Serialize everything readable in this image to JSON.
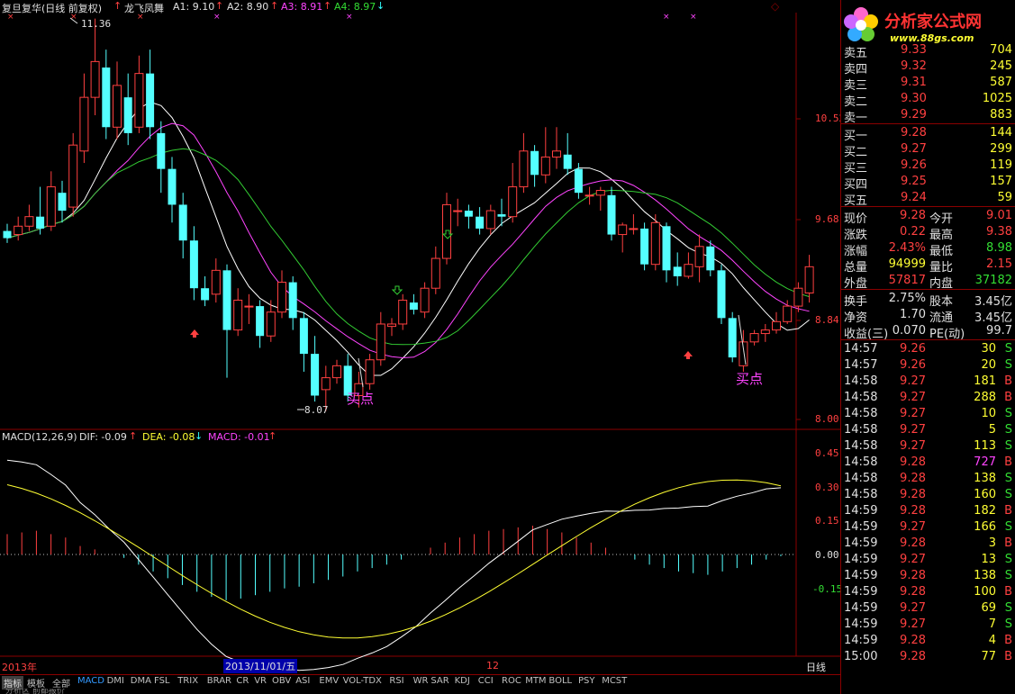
{
  "header": {
    "stock_name": "复旦复华(日线 前复权)",
    "diamond_icon": "◇",
    "indicator_name": "龙飞凤舞",
    "a1_label": "A1: 9.10",
    "a2_label": "A2: 8.90",
    "a3_label": "A3: 8.91",
    "a4_label": "A4: 8.97"
  },
  "main_chart": {
    "price_axis": [
      "10.52",
      "9.68",
      "8.84",
      "8.00"
    ],
    "high_annotation": "11.36",
    "low_annotation": "8.07",
    "buy_label_1": "买点",
    "buy_label_2": "买点",
    "ma_colors": {
      "white": "#ffffff",
      "magenta": "#ff44ff",
      "green": "#33cc33"
    },
    "up_color": "#ff4040",
    "down_color": "#54ffff"
  },
  "macd": {
    "header_name": "MACD(12,26,9)",
    "dif_label": "DIF: -0.09",
    "dea_label": "DEA: -0.08",
    "macd_label": "MACD: -0.01",
    "axis": [
      "0.45",
      "0.30",
      "0.15",
      "0.00",
      "-0.15"
    ]
  },
  "x_axis": {
    "year_label": "2013年",
    "date_label": "2013/11/01/五",
    "month_label": "12",
    "period_label": "日线"
  },
  "tabs": [
    "指标",
    "模板",
    "全部",
    "MACD",
    "DMI",
    "DMA",
    "FSL",
    "TRIX",
    "BRAR",
    "CR",
    "VR",
    "OBV",
    "ASI",
    "EMV",
    "VOL-TDX",
    "RSI",
    "WR",
    "SAR",
    "KDJ",
    "CCI",
    "ROC",
    "MTM",
    "BOLL",
    "PSY",
    "MCST"
  ],
  "bottom_text": "分析区 前都报价",
  "logo": {
    "title": "分析家公式网",
    "url": "www.88gs.com"
  },
  "order_book": {
    "sell": [
      {
        "label": "卖五",
        "price": "9.33",
        "volume": "704"
      },
      {
        "label": "卖四",
        "price": "9.32",
        "volume": "245"
      },
      {
        "label": "卖三",
        "price": "9.31",
        "volume": "587"
      },
      {
        "label": "卖二",
        "price": "9.30",
        "volume": "1025"
      },
      {
        "label": "卖一",
        "price": "9.29",
        "volume": "883"
      }
    ],
    "buy": [
      {
        "label": "买一",
        "price": "9.28",
        "volume": "144"
      },
      {
        "label": "买二",
        "price": "9.27",
        "volume": "299"
      },
      {
        "label": "买三",
        "price": "9.26",
        "volume": "119"
      },
      {
        "label": "买四",
        "price": "9.25",
        "volume": "157"
      },
      {
        "label": "买五",
        "price": "9.24",
        "volume": "59"
      }
    ]
  },
  "quote": [
    {
      "l1": "现价",
      "v1": "9.28",
      "l2": "今开",
      "v2": "9.01"
    },
    {
      "l1": "涨跌",
      "v1": "0.22",
      "l2": "最高",
      "v2": "9.38"
    },
    {
      "l1": "涨幅",
      "v1": "2.43%",
      "l2": "最低",
      "v2": "8.98"
    },
    {
      "l1": "总量",
      "v1": "94999",
      "l2": "量比",
      "v2": "2.15"
    },
    {
      "l1": "外盘",
      "v1": "57817",
      "l2": "内盘",
      "v2": "37182"
    }
  ],
  "fundamentals": [
    {
      "l1": "换手",
      "v1": "2.75%",
      "l2": "股本",
      "v2": "3.45亿"
    },
    {
      "l1": "净资",
      "v1": "1.70",
      "l2": "流通",
      "v2": "3.45亿"
    },
    {
      "l1": "收益(三)",
      "v1": "0.070",
      "l2": "PE(动)",
      "v2": "99.7"
    }
  ],
  "ticks": [
    {
      "time": "14:57",
      "price": "9.26",
      "vol": "30",
      "side": "S"
    },
    {
      "time": "14:57",
      "price": "9.26",
      "vol": "20",
      "side": "S"
    },
    {
      "time": "14:58",
      "price": "9.27",
      "vol": "181",
      "side": "B"
    },
    {
      "time": "14:58",
      "price": "9.27",
      "vol": "288",
      "side": "B"
    },
    {
      "time": "14:58",
      "price": "9.27",
      "vol": "10",
      "side": "S"
    },
    {
      "time": "14:58",
      "price": "9.27",
      "vol": "5",
      "side": "S"
    },
    {
      "time": "14:58",
      "price": "9.27",
      "vol": "113",
      "side": "S"
    },
    {
      "time": "14:58",
      "price": "9.28",
      "vol": "727",
      "side": "B"
    },
    {
      "time": "14:58",
      "price": "9.28",
      "vol": "138",
      "side": "S"
    },
    {
      "time": "14:58",
      "price": "9.28",
      "vol": "160",
      "side": "S"
    },
    {
      "time": "14:59",
      "price": "9.28",
      "vol": "182",
      "side": "B"
    },
    {
      "time": "14:59",
      "price": "9.27",
      "vol": "166",
      "side": "S"
    },
    {
      "time": "14:59",
      "price": "9.28",
      "vol": "3",
      "side": "B"
    },
    {
      "time": "14:59",
      "price": "9.27",
      "vol": "13",
      "side": "S"
    },
    {
      "time": "14:59",
      "price": "9.28",
      "vol": "138",
      "side": "S"
    },
    {
      "time": "14:59",
      "price": "9.28",
      "vol": "100",
      "side": "B"
    },
    {
      "time": "14:59",
      "price": "9.27",
      "vol": "69",
      "side": "S"
    },
    {
      "time": "14:59",
      "price": "9.27",
      "vol": "7",
      "side": "S"
    },
    {
      "time": "14:59",
      "price": "9.28",
      "vol": "4",
      "side": "B"
    },
    {
      "time": "15:00",
      "price": "9.28",
      "vol": "77",
      "side": "B"
    }
  ],
  "chart_data": {
    "type": "candlestick",
    "price_ylim": [
      8.0,
      11.36
    ],
    "candles": [
      [
        9.58,
        9.52,
        9.64,
        9.48
      ],
      [
        9.55,
        9.62,
        9.7,
        9.5
      ],
      [
        9.62,
        9.7,
        9.8,
        9.58
      ],
      [
        9.7,
        9.6,
        9.95,
        9.55
      ],
      [
        9.62,
        9.95,
        10.08,
        9.58
      ],
      [
        9.9,
        9.75,
        10.0,
        9.65
      ],
      [
        9.78,
        10.3,
        10.4,
        9.7
      ],
      [
        10.25,
        10.7,
        10.9,
        10.15
      ],
      [
        10.7,
        11.0,
        11.36,
        10.55
      ],
      [
        10.95,
        10.45,
        11.1,
        10.35
      ],
      [
        10.45,
        10.8,
        11.0,
        10.35
      ],
      [
        10.7,
        10.4,
        10.9,
        10.3
      ],
      [
        10.45,
        10.9,
        11.05,
        10.4
      ],
      [
        10.9,
        10.45,
        11.1,
        10.35
      ],
      [
        10.4,
        10.1,
        10.5,
        9.9
      ],
      [
        10.1,
        9.8,
        10.2,
        9.65
      ],
      [
        9.8,
        9.5,
        9.9,
        9.35
      ],
      [
        9.5,
        9.1,
        9.62,
        9.0
      ],
      [
        9.1,
        9.0,
        9.2,
        8.95
      ],
      [
        9.05,
        9.25,
        9.35,
        8.98
      ],
      [
        9.25,
        8.75,
        9.3,
        8.35
      ],
      [
        8.75,
        9.0,
        9.1,
        8.7
      ],
      [
        8.95,
        8.95,
        9.05,
        8.8
      ],
      [
        8.95,
        8.7,
        9.0,
        8.6
      ],
      [
        8.7,
        8.9,
        9.0,
        8.65
      ],
      [
        8.9,
        9.15,
        9.25,
        8.85
      ],
      [
        9.15,
        8.85,
        9.2,
        8.75
      ],
      [
        8.85,
        8.55,
        8.9,
        8.4
      ],
      [
        8.55,
        8.2,
        8.7,
        8.15
      ],
      [
        8.25,
        8.35,
        8.45,
        8.07
      ],
      [
        8.35,
        8.45,
        8.5,
        8.3
      ],
      [
        8.45,
        8.2,
        8.55,
        8.15
      ],
      [
        8.2,
        8.3,
        8.4,
        8.1
      ],
      [
        8.3,
        8.5,
        8.55,
        8.25
      ],
      [
        8.5,
        8.8,
        8.9,
        8.45
      ],
      [
        8.78,
        8.8,
        8.85,
        8.7
      ],
      [
        8.8,
        9.0,
        9.05,
        8.75
      ],
      [
        8.98,
        8.92,
        9.05,
        8.88
      ],
      [
        8.9,
        9.1,
        9.15,
        8.85
      ],
      [
        9.1,
        9.35,
        9.45,
        9.05
      ],
      [
        9.35,
        9.8,
        9.9,
        9.3
      ],
      [
        9.75,
        9.75,
        9.85,
        9.62
      ],
      [
        9.75,
        9.7,
        9.8,
        9.6
      ],
      [
        9.7,
        9.6,
        9.78,
        9.55
      ],
      [
        9.6,
        9.75,
        9.8,
        9.55
      ],
      [
        9.72,
        9.7,
        9.85,
        9.62
      ],
      [
        9.7,
        9.95,
        10.15,
        9.65
      ],
      [
        9.95,
        10.25,
        10.4,
        9.9
      ],
      [
        10.25,
        10.05,
        10.3,
        9.95
      ],
      [
        10.05,
        10.2,
        10.45,
        9.98
      ],
      [
        10.2,
        10.25,
        10.45,
        10.1
      ],
      [
        10.22,
        10.1,
        10.4,
        10.05
      ],
      [
        10.1,
        9.9,
        10.15,
        9.85
      ],
      [
        9.88,
        9.88,
        9.95,
        9.8
      ],
      [
        9.88,
        9.92,
        9.95,
        9.75
      ],
      [
        9.88,
        9.55,
        9.95,
        9.5
      ],
      [
        9.55,
        9.63,
        9.65,
        9.4
      ],
      [
        9.6,
        9.6,
        9.72,
        9.55
      ],
      [
        9.6,
        9.3,
        9.65,
        9.25
      ],
      [
        9.3,
        9.65,
        9.72,
        9.25
      ],
      [
        9.62,
        9.25,
        9.65,
        9.15
      ],
      [
        9.28,
        9.2,
        9.4,
        9.12
      ],
      [
        9.2,
        9.3,
        9.4,
        9.18
      ],
      [
        9.28,
        9.45,
        9.55,
        9.15
      ],
      [
        9.45,
        9.25,
        9.5,
        9.2
      ],
      [
        9.25,
        8.85,
        9.3,
        8.8
      ],
      [
        8.85,
        8.52,
        8.9,
        8.48
      ],
      [
        8.45,
        8.65,
        8.75,
        8.4
      ],
      [
        8.65,
        8.72,
        8.75,
        8.62
      ],
      [
        8.72,
        8.75,
        8.8,
        8.65
      ],
      [
        8.75,
        8.82,
        8.9,
        8.72
      ],
      [
        8.82,
        8.95,
        9.0,
        8.8
      ],
      [
        8.95,
        9.1,
        9.15,
        8.9
      ],
      [
        9.06,
        9.28,
        9.38,
        8.98
      ]
    ],
    "macd_ylim": [
      -0.3,
      0.55
    ],
    "macd_hist": [
      0.12,
      0.13,
      0.14,
      0.12,
      0.1,
      0.05,
      0.03,
      0.0,
      -0.02,
      -0.06,
      -0.1,
      -0.14,
      -0.18,
      -0.22,
      -0.25,
      -0.27,
      -0.26,
      -0.24,
      -0.22,
      -0.2,
      -0.19,
      -0.17,
      -0.15,
      -0.13,
      -0.1,
      -0.08,
      -0.06,
      -0.03,
      0.0,
      0.04,
      0.07,
      0.1,
      0.12,
      0.14,
      0.15,
      0.16,
      0.17,
      0.15,
      0.13,
      0.1,
      0.07,
      0.04,
      0.0,
      -0.03,
      -0.06,
      -0.08,
      -0.1,
      -0.11,
      -0.12,
      -0.1,
      -0.08,
      -0.06,
      -0.03,
      -0.01
    ]
  }
}
